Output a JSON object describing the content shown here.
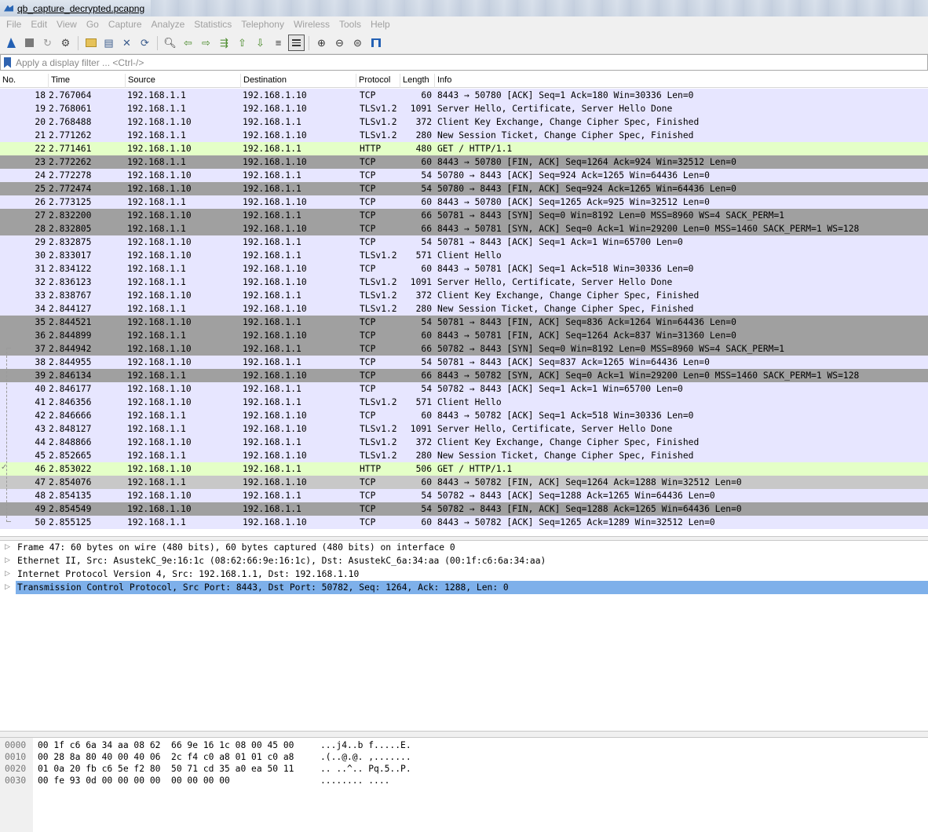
{
  "window": {
    "title": "qb_capture_decrypted.pcapng"
  },
  "menu": [
    "File",
    "Edit",
    "View",
    "Go",
    "Capture",
    "Analyze",
    "Statistics",
    "Telephony",
    "Wireless",
    "Tools",
    "Help"
  ],
  "toolbar": {
    "icons": [
      "start-capture-icon",
      "stop-capture-icon",
      "restart-capture-icon",
      "capture-options-icon",
      "open-file-icon",
      "save-file-icon",
      "close-file-icon",
      "reload-file-icon",
      "find-packet-icon",
      "go-back-icon",
      "go-forward-icon",
      "go-to-packet-icon",
      "go-first-icon",
      "go-last-icon",
      "autoscroll-icon",
      "colorize-icon",
      "zoom-in-icon",
      "zoom-out-icon",
      "normal-size-icon",
      "resize-columns-icon"
    ]
  },
  "filter": {
    "placeholder": "Apply a display filter ... <Ctrl-/>"
  },
  "columns": {
    "no": "No.",
    "time": "Time",
    "source": "Source",
    "destination": "Destination",
    "protocol": "Protocol",
    "length": "Length",
    "info": "Info"
  },
  "packets": [
    {
      "no": "18",
      "time": "2.767064",
      "src": "192.168.1.1",
      "dst": "192.168.1.10",
      "proto": "TCP",
      "len": "60",
      "info": "8443 → 50780 [ACK] Seq=1 Ack=180 Win=30336 Len=0",
      "color": "tcp"
    },
    {
      "no": "19",
      "time": "2.768061",
      "src": "192.168.1.1",
      "dst": "192.168.1.10",
      "proto": "TLSv1.2",
      "len": "1091",
      "info": "Server Hello, Certificate, Server Hello Done",
      "color": "tcp"
    },
    {
      "no": "20",
      "time": "2.768488",
      "src": "192.168.1.10",
      "dst": "192.168.1.1",
      "proto": "TLSv1.2",
      "len": "372",
      "info": "Client Key Exchange, Change Cipher Spec, Finished",
      "color": "tcp"
    },
    {
      "no": "21",
      "time": "2.771262",
      "src": "192.168.1.1",
      "dst": "192.168.1.10",
      "proto": "TLSv1.2",
      "len": "280",
      "info": "New Session Ticket, Change Cipher Spec, Finished",
      "color": "tcp"
    },
    {
      "no": "22",
      "time": "2.771461",
      "src": "192.168.1.10",
      "dst": "192.168.1.1",
      "proto": "HTTP",
      "len": "480",
      "info": "GET / HTTP/1.1",
      "color": "http"
    },
    {
      "no": "23",
      "time": "2.772262",
      "src": "192.168.1.1",
      "dst": "192.168.1.10",
      "proto": "TCP",
      "len": "60",
      "info": "8443 → 50780 [FIN, ACK] Seq=1264 Ack=924 Win=32512 Len=0",
      "color": "bad"
    },
    {
      "no": "24",
      "time": "2.772278",
      "src": "192.168.1.10",
      "dst": "192.168.1.1",
      "proto": "TCP",
      "len": "54",
      "info": "50780 → 8443 [ACK] Seq=924 Ack=1265 Win=64436 Len=0",
      "color": "tcp"
    },
    {
      "no": "25",
      "time": "2.772474",
      "src": "192.168.1.10",
      "dst": "192.168.1.1",
      "proto": "TCP",
      "len": "54",
      "info": "50780 → 8443 [FIN, ACK] Seq=924 Ack=1265 Win=64436 Len=0",
      "color": "bad"
    },
    {
      "no": "26",
      "time": "2.773125",
      "src": "192.168.1.1",
      "dst": "192.168.1.10",
      "proto": "TCP",
      "len": "60",
      "info": "8443 → 50780 [ACK] Seq=1265 Ack=925 Win=32512 Len=0",
      "color": "tcp"
    },
    {
      "no": "27",
      "time": "2.832200",
      "src": "192.168.1.10",
      "dst": "192.168.1.1",
      "proto": "TCP",
      "len": "66",
      "info": "50781 → 8443 [SYN] Seq=0 Win=8192 Len=0 MSS=8960 WS=4 SACK_PERM=1",
      "color": "bad"
    },
    {
      "no": "28",
      "time": "2.832805",
      "src": "192.168.1.1",
      "dst": "192.168.1.10",
      "proto": "TCP",
      "len": "66",
      "info": "8443 → 50781 [SYN, ACK] Seq=0 Ack=1 Win=29200 Len=0 MSS=1460 SACK_PERM=1 WS=128",
      "color": "bad"
    },
    {
      "no": "29",
      "time": "2.832875",
      "src": "192.168.1.10",
      "dst": "192.168.1.1",
      "proto": "TCP",
      "len": "54",
      "info": "50781 → 8443 [ACK] Seq=1 Ack=1 Win=65700 Len=0",
      "color": "tcp"
    },
    {
      "no": "30",
      "time": "2.833017",
      "src": "192.168.1.10",
      "dst": "192.168.1.1",
      "proto": "TLSv1.2",
      "len": "571",
      "info": "Client Hello",
      "color": "tcp"
    },
    {
      "no": "31",
      "time": "2.834122",
      "src": "192.168.1.1",
      "dst": "192.168.1.10",
      "proto": "TCP",
      "len": "60",
      "info": "8443 → 50781 [ACK] Seq=1 Ack=518 Win=30336 Len=0",
      "color": "tcp"
    },
    {
      "no": "32",
      "time": "2.836123",
      "src": "192.168.1.1",
      "dst": "192.168.1.10",
      "proto": "TLSv1.2",
      "len": "1091",
      "info": "Server Hello, Certificate, Server Hello Done",
      "color": "tcp"
    },
    {
      "no": "33",
      "time": "2.838767",
      "src": "192.168.1.10",
      "dst": "192.168.1.1",
      "proto": "TLSv1.2",
      "len": "372",
      "info": "Client Key Exchange, Change Cipher Spec, Finished",
      "color": "tcp"
    },
    {
      "no": "34",
      "time": "2.844127",
      "src": "192.168.1.1",
      "dst": "192.168.1.10",
      "proto": "TLSv1.2",
      "len": "280",
      "info": "New Session Ticket, Change Cipher Spec, Finished",
      "color": "tcp"
    },
    {
      "no": "35",
      "time": "2.844521",
      "src": "192.168.1.10",
      "dst": "192.168.1.1",
      "proto": "TCP",
      "len": "54",
      "info": "50781 → 8443 [FIN, ACK] Seq=836 Ack=1264 Win=64436 Len=0",
      "color": "bad"
    },
    {
      "no": "36",
      "time": "2.844899",
      "src": "192.168.1.1",
      "dst": "192.168.1.10",
      "proto": "TCP",
      "len": "60",
      "info": "8443 → 50781 [FIN, ACK] Seq=1264 Ack=837 Win=31360 Len=0",
      "color": "bad"
    },
    {
      "no": "37",
      "time": "2.844942",
      "src": "192.168.1.10",
      "dst": "192.168.1.1",
      "proto": "TCP",
      "len": "66",
      "info": "50782 → 8443 [SYN] Seq=0 Win=8192 Len=0 MSS=8960 WS=4 SACK_PERM=1",
      "color": "bad"
    },
    {
      "no": "38",
      "time": "2.844955",
      "src": "192.168.1.10",
      "dst": "192.168.1.1",
      "proto": "TCP",
      "len": "54",
      "info": "50781 → 8443 [ACK] Seq=837 Ack=1265 Win=64436 Len=0",
      "color": "tcp"
    },
    {
      "no": "39",
      "time": "2.846134",
      "src": "192.168.1.1",
      "dst": "192.168.1.10",
      "proto": "TCP",
      "len": "66",
      "info": "8443 → 50782 [SYN, ACK] Seq=0 Ack=1 Win=29200 Len=0 MSS=1460 SACK_PERM=1 WS=128",
      "color": "bad"
    },
    {
      "no": "40",
      "time": "2.846177",
      "src": "192.168.1.10",
      "dst": "192.168.1.1",
      "proto": "TCP",
      "len": "54",
      "info": "50782 → 8443 [ACK] Seq=1 Ack=1 Win=65700 Len=0",
      "color": "tcp"
    },
    {
      "no": "41",
      "time": "2.846356",
      "src": "192.168.1.10",
      "dst": "192.168.1.1",
      "proto": "TLSv1.2",
      "len": "571",
      "info": "Client Hello",
      "color": "tcp"
    },
    {
      "no": "42",
      "time": "2.846666",
      "src": "192.168.1.1",
      "dst": "192.168.1.10",
      "proto": "TCP",
      "len": "60",
      "info": "8443 → 50782 [ACK] Seq=1 Ack=518 Win=30336 Len=0",
      "color": "tcp"
    },
    {
      "no": "43",
      "time": "2.848127",
      "src": "192.168.1.1",
      "dst": "192.168.1.10",
      "proto": "TLSv1.2",
      "len": "1091",
      "info": "Server Hello, Certificate, Server Hello Done",
      "color": "tcp"
    },
    {
      "no": "44",
      "time": "2.848866",
      "src": "192.168.1.10",
      "dst": "192.168.1.1",
      "proto": "TLSv1.2",
      "len": "372",
      "info": "Client Key Exchange, Change Cipher Spec, Finished",
      "color": "tcp"
    },
    {
      "no": "45",
      "time": "2.852665",
      "src": "192.168.1.1",
      "dst": "192.168.1.10",
      "proto": "TLSv1.2",
      "len": "280",
      "info": "New Session Ticket, Change Cipher Spec, Finished",
      "color": "tcp"
    },
    {
      "no": "46",
      "time": "2.853022",
      "src": "192.168.1.10",
      "dst": "192.168.1.1",
      "proto": "HTTP",
      "len": "506",
      "info": "GET / HTTP/1.1",
      "color": "http"
    },
    {
      "no": "47",
      "time": "2.854076",
      "src": "192.168.1.1",
      "dst": "192.168.1.10",
      "proto": "TCP",
      "len": "60",
      "info": "8443 → 50782 [FIN, ACK] Seq=1264 Ack=1288 Win=32512 Len=0",
      "color": "sel"
    },
    {
      "no": "48",
      "time": "2.854135",
      "src": "192.168.1.10",
      "dst": "192.168.1.1",
      "proto": "TCP",
      "len": "54",
      "info": "50782 → 8443 [ACK] Seq=1288 Ack=1265 Win=64436 Len=0",
      "color": "tcp"
    },
    {
      "no": "49",
      "time": "2.854549",
      "src": "192.168.1.10",
      "dst": "192.168.1.1",
      "proto": "TCP",
      "len": "54",
      "info": "50782 → 8443 [FIN, ACK] Seq=1288 Ack=1265 Win=64436 Len=0",
      "color": "bad"
    },
    {
      "no": "50",
      "time": "2.855125",
      "src": "192.168.1.1",
      "dst": "192.168.1.10",
      "proto": "TCP",
      "len": "60",
      "info": "8443 → 50782 [ACK] Seq=1265 Ack=1289 Win=32512 Len=0",
      "color": "tcp"
    }
  ],
  "details": [
    {
      "text": "Frame 47: 60 bytes on wire (480 bits), 60 bytes captured (480 bits) on interface 0",
      "selected": false
    },
    {
      "text": "Ethernet II, Src: AsustekC_9e:16:1c (08:62:66:9e:16:1c), Dst: AsustekC_6a:34:aa (00:1f:c6:6a:34:aa)",
      "selected": false
    },
    {
      "text": "Internet Protocol Version 4, Src: 192.168.1.1, Dst: 192.168.1.10",
      "selected": false
    },
    {
      "text": "Transmission Control Protocol, Src Port: 8443, Dst Port: 50782, Seq: 1264, Ack: 1288, Len: 0",
      "selected": true
    }
  ],
  "bytes": [
    {
      "offset": "0000",
      "hex": "00 1f c6 6a 34 aa 08 62  66 9e 16 1c 08 00 45 00",
      "ascii": "...j4..b f.....E."
    },
    {
      "offset": "0010",
      "hex": "00 28 8a 80 40 00 40 06  2c f4 c0 a8 01 01 c0 a8",
      "ascii": ".(..@.@. ,......."
    },
    {
      "offset": "0020",
      "hex": "01 0a 20 fb c6 5e f2 80  50 71 cd 35 a0 ea 50 11",
      "ascii": ".. ..^.. Pq.5..P."
    },
    {
      "offset": "0030",
      "hex": "00 fe 93 0d 00 00 00 00  00 00 00 00",
      "ascii": "........ ...."
    }
  ],
  "colors": {
    "tcp": "#e7e6ff",
    "http": "#e4ffc7",
    "bad": "#a0a0a0",
    "selected_row": "#c8c8c8",
    "selected_detail": "#7eb0ea"
  }
}
